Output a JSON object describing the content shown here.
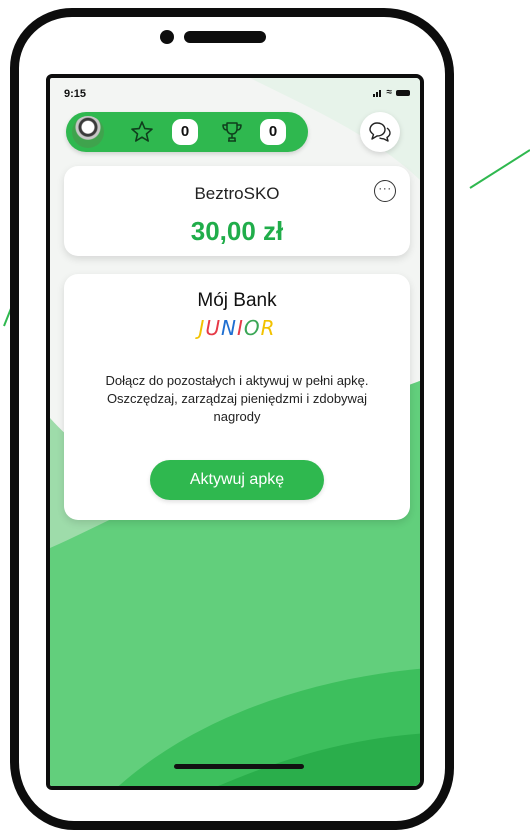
{
  "status": {
    "time": "9:15"
  },
  "points": {
    "stars": "0",
    "trophies": "0"
  },
  "account": {
    "name": "BeztroSKO",
    "balance": "30,00 zł"
  },
  "promo": {
    "title": "Mój Bank",
    "logo_letters": [
      {
        "char": "J",
        "color": "#f2c200"
      },
      {
        "char": "U",
        "color": "#e63946"
      },
      {
        "char": "N",
        "color": "#1f6fd1"
      },
      {
        "char": "I",
        "color": "#e63946"
      },
      {
        "char": "O",
        "color": "#3aa655"
      },
      {
        "char": "R",
        "color": "#f2c200"
      }
    ],
    "description": "Dołącz do pozostałych i aktywuj w pełni apkę. Oszczędzaj, zarządzaj pieniędzmi i zdobywaj nagrody",
    "button_label": "Aktywuj apkę"
  },
  "colors": {
    "accent": "#2fb84f",
    "balance": "#20ad4a"
  }
}
